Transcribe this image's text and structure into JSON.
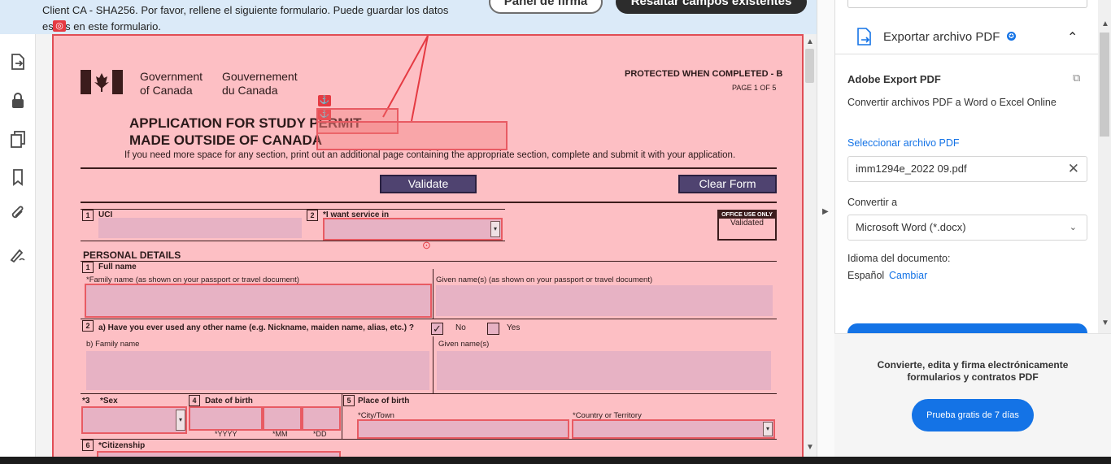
{
  "notice": {
    "text_line1": "Client CA - SHA256.  Por favor, rellene el siguiente formulario. Puede guardar los datos",
    "text_line2": "es  tos en este formulario.",
    "panel_button": "Panel de firma",
    "highlight_button": "Resaltar campos existentes"
  },
  "form": {
    "gov_en_1": "Government",
    "gov_en_2": "of Canada",
    "gov_fr_1": "Gouvernement",
    "gov_fr_2": "du Canada",
    "protected": "PROTECTED WHEN COMPLETED - B",
    "page_of": "PAGE 1 OF 5",
    "title_1": "APPLICATION FOR STUDY PERMIT",
    "title_2": "MADE OUTSIDE OF CANADA",
    "instruction": "If you need more space for any section, print out an additional page containing the appropriate section, complete and submit it with your application.",
    "validate_btn": "Validate",
    "clear_btn": "Clear Form",
    "office_use": "OFFICE USE ONLY",
    "office_validated": "Validated",
    "q1_num": "1",
    "q1_label": "UCI",
    "q2_num": "2",
    "q2_label": "*I want service in",
    "personal_details": "PERSONAL DETAILS",
    "full_name_num": "1",
    "full_name": "Full name",
    "family_name_label": "*Family name (as shown on your passport or travel document)",
    "given_name_label": "Given name(s) (as shown on your passport or travel document)",
    "other_name_num": "2",
    "other_name_q": "a) Have you ever used any other name (e.g. Nickname, maiden name, alias, etc.) ?",
    "no": "No",
    "yes": "Yes",
    "b_family": "b) Family name",
    "b_given": "Given name(s)",
    "sex_num": "*3",
    "sex": "*Sex",
    "dob_num": "4",
    "dob": "Date of birth",
    "yyyy": "*YYYY",
    "mm": "*MM",
    "dd": "*DD",
    "pob_num": "5",
    "pob": "Place of birth",
    "city": "*City/Town",
    "country": "*Country or Territory",
    "cit_num": "6",
    "citizenship": "*Citizenship"
  },
  "right_panel": {
    "export_title": "Exportar archivo PDF",
    "adobe_export": "Adobe Export PDF",
    "convert_desc": "Convertir archivos PDF a Word o Excel Online",
    "select_file": "Seleccionar archivo PDF",
    "file_name": "imm1294e_2022 09.pdf",
    "convert_to": "Convertir a",
    "format": "Microsoft Word (*.docx)",
    "doc_lang": "Idioma del documento:",
    "lang": "Español",
    "change": "Cambiar",
    "promo_1": "Convierte, edita y firma electrónicamente",
    "promo_2": "formularios y contratos PDF",
    "trial_btn": "Prueba gratis de 7 días"
  },
  "colors": {
    "highlight_fill": "#fdbfc4",
    "highlight_border": "#e04d55",
    "field_fill": "#e7b2c4",
    "button_purple": "#4f4370",
    "accent_blue": "#1473e6"
  },
  "icons": [
    "user-icon",
    "export-pdf-icon",
    "lock-icon",
    "copy-pages-icon",
    "bookmark-icon",
    "attachment-icon",
    "sign-icon",
    "collapse-left-icon",
    "expand-right-icon",
    "chevron-up-icon",
    "chevron-down-icon",
    "clear-icon",
    "anchor-icon",
    "target-icon",
    "dropdown-arrow-icon",
    "checkmark-icon"
  ]
}
